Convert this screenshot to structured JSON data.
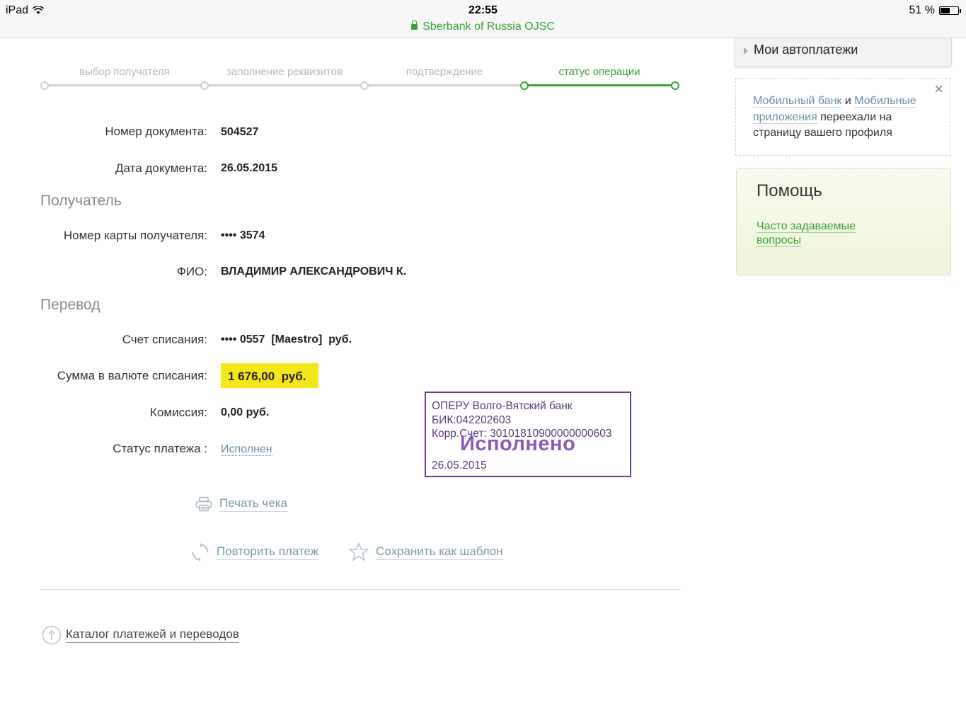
{
  "status_bar": {
    "device": "iPad",
    "time": "22:55",
    "url": "Sberbank of Russia  OJSC",
    "battery": "51 %"
  },
  "steps": [
    {
      "label": "выбор получателя",
      "active": false
    },
    {
      "label": "заполнение реквизитов",
      "active": false
    },
    {
      "label": "подтверждение",
      "active": false
    },
    {
      "label": "статус операции",
      "active": true
    }
  ],
  "document": {
    "number_label": "Номер документа:",
    "number": "504527",
    "date_label": "Дата документа:",
    "date": "26.05.2015"
  },
  "recipient": {
    "section_title": "Получатель",
    "card_label": "Номер карты получателя:",
    "card": "•••• 3574",
    "name_label": "ФИО:",
    "name": "ВЛАДИМИР АЛЕКСАНДРОВИЧ К."
  },
  "transfer": {
    "section_title": "Перевод",
    "account_label": "Счет списания:",
    "account": "•••• 0557  [Maestro]  руб.",
    "amount_label": "Сумма в валюте списания:",
    "amount": "1 676,00  руб.",
    "fee_label": "Комиссия:",
    "fee": "0,00 руб.",
    "status_label": "Статус платежа :",
    "status": "Исполнен"
  },
  "stamp": {
    "line1": "ОПЕРУ Волго-Вятский банк",
    "line2": "БИК:042202603",
    "line3": "Корр.Счет: 30101810900000000603",
    "status": "Исполнено",
    "date": "26.05.2015"
  },
  "actions": {
    "print": "Печать чека",
    "repeat": "Повторить платеж",
    "save_template": "Сохранить как шаблон",
    "catalog": "Каталог платежей и переводов"
  },
  "sidebar": {
    "autopay": "Мои автоплатежи",
    "notice_link1": "Мобильный банк",
    "notice_and": " и ",
    "notice_link2": "Мобильные приложения",
    "notice_rest": " переехали на страницу вашего профиля",
    "close": "×",
    "help_title": "Помощь",
    "faq": "Часто задаваемые вопросы"
  },
  "colors": {
    "accent_green": "#3aa037",
    "highlight_yellow": "#f5e61a",
    "stamp_purple": "#6a3b8e"
  }
}
